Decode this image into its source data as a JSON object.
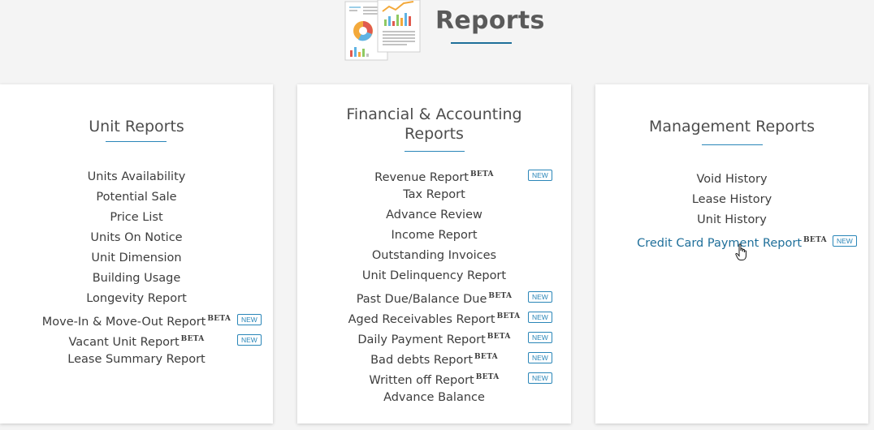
{
  "page": {
    "title": "Reports"
  },
  "colors": {
    "accent": "#1f6f9a",
    "underline": "#2a86b8",
    "badge": "#2a86b8",
    "background": "#f4f4f4",
    "card": "#ffffff"
  },
  "icons": {
    "header": "reports-illustration-icon",
    "cursor": "hand-pointer-icon"
  },
  "cards": [
    {
      "title": "Unit Reports",
      "items": [
        {
          "label": "Units Availability",
          "beta": "",
          "new": ""
        },
        {
          "label": "Potential Sale",
          "beta": "",
          "new": ""
        },
        {
          "label": "Price List",
          "beta": "",
          "new": ""
        },
        {
          "label": "Units On Notice",
          "beta": "",
          "new": ""
        },
        {
          "label": "Unit Dimension",
          "beta": "",
          "new": ""
        },
        {
          "label": "Building Usage",
          "beta": "",
          "new": ""
        },
        {
          "label": "Longevity Report",
          "beta": "",
          "new": ""
        },
        {
          "label": "Move-In & Move-Out Report",
          "beta": "BETA",
          "new": "NEW"
        },
        {
          "label": "Vacant Unit Report",
          "beta": "BETA",
          "new": "NEW"
        },
        {
          "label": "Lease Summary Report",
          "beta": "",
          "new": ""
        }
      ]
    },
    {
      "title_line1": "Financial & Accounting",
      "title_line2": "Reports",
      "items": [
        {
          "label": "Revenue Report",
          "beta": "BETA",
          "new": "NEW"
        },
        {
          "label": "Tax Report",
          "beta": "",
          "new": ""
        },
        {
          "label": "Advance Review",
          "beta": "",
          "new": ""
        },
        {
          "label": "Income Report",
          "beta": "",
          "new": ""
        },
        {
          "label": "Outstanding Invoices",
          "beta": "",
          "new": ""
        },
        {
          "label": "Unit Delinquency Report",
          "beta": "",
          "new": ""
        },
        {
          "label": "Past Due/Balance Due",
          "beta": "BETA",
          "new": "NEW"
        },
        {
          "label": "Aged Receivables Report",
          "beta": "BETA",
          "new": "NEW"
        },
        {
          "label": "Daily Payment Report",
          "beta": "BETA",
          "new": "NEW"
        },
        {
          "label": "Bad debts Report",
          "beta": "BETA",
          "new": "NEW"
        },
        {
          "label": "Written off Report",
          "beta": "BETA",
          "new": "NEW"
        },
        {
          "label": "Advance Balance",
          "beta": "",
          "new": ""
        }
      ]
    },
    {
      "title": "Management Reports",
      "items": [
        {
          "label": "Void History",
          "beta": "",
          "new": ""
        },
        {
          "label": "Lease History",
          "beta": "",
          "new": ""
        },
        {
          "label": "Unit History",
          "beta": "",
          "new": ""
        },
        {
          "label": "Credit Card Payment Report",
          "beta": "BETA",
          "new": "NEW"
        }
      ]
    }
  ]
}
